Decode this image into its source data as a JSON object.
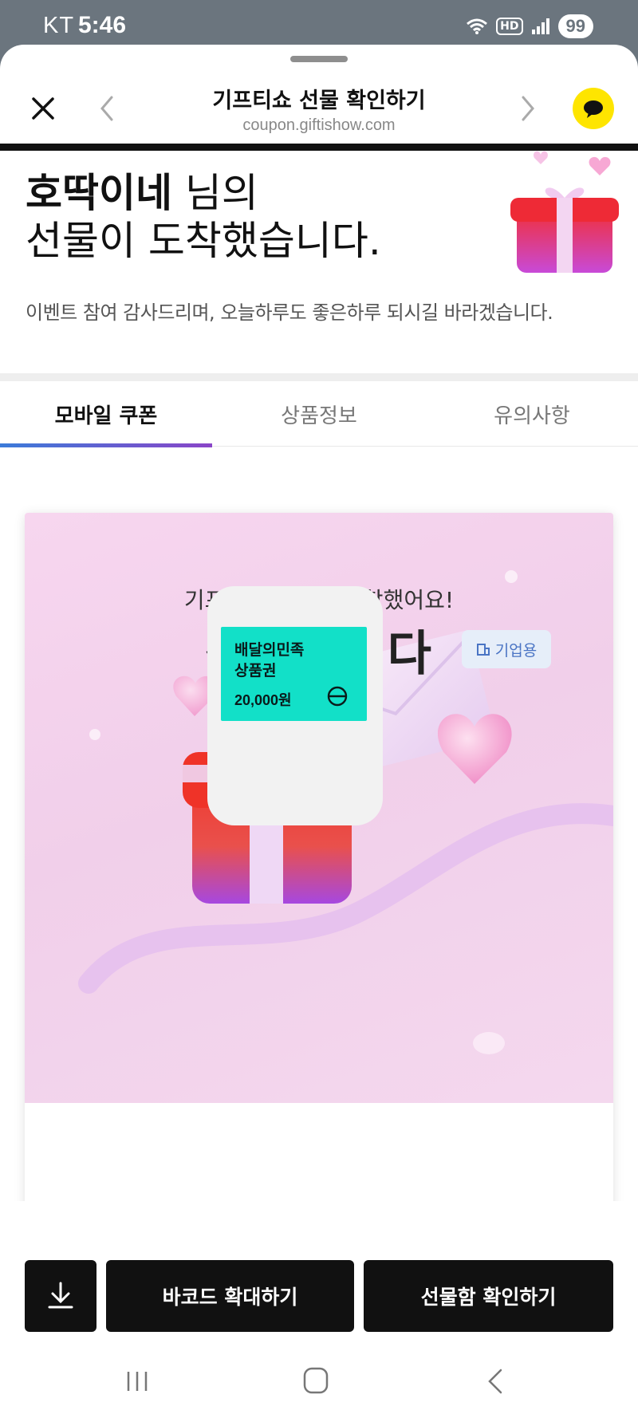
{
  "status_bar": {
    "carrier": "KT",
    "time": "5:46",
    "hd_label": "HD",
    "battery": "99"
  },
  "nav": {
    "title": "기프티쇼 선물 확인하기",
    "url": "coupon.giftishow.com"
  },
  "hero": {
    "sender_name": "호딱이네",
    "sender_suffix": " 님의",
    "headline_line2": "선물이 도착했습니다.",
    "message": "이벤트 참여 감사드리며, 오늘하루도 좋은하루 되시길 바라겠습니다."
  },
  "tabs": [
    {
      "label": "모바일 쿠폰",
      "active": true
    },
    {
      "label": "상품정보",
      "active": false
    },
    {
      "label": "유의사항",
      "active": false
    }
  ],
  "card": {
    "subtitle": "기프티쇼 선물이 도착했어요!",
    "title": "감사합니다",
    "product": {
      "brand_line1": "배달의민족",
      "brand_line2": "상품권",
      "price": "20,000원"
    },
    "badge": "기업용"
  },
  "actions": {
    "zoom_barcode": "바코드 확대하기",
    "open_giftbox": "선물함 확인하기"
  },
  "colors": {
    "accent_tab_start": "#3b7bd9",
    "accent_tab_end": "#8a45c8",
    "kakao_yellow": "#fee500",
    "product_tile": "#12e0c8",
    "button_dark": "#111111"
  }
}
